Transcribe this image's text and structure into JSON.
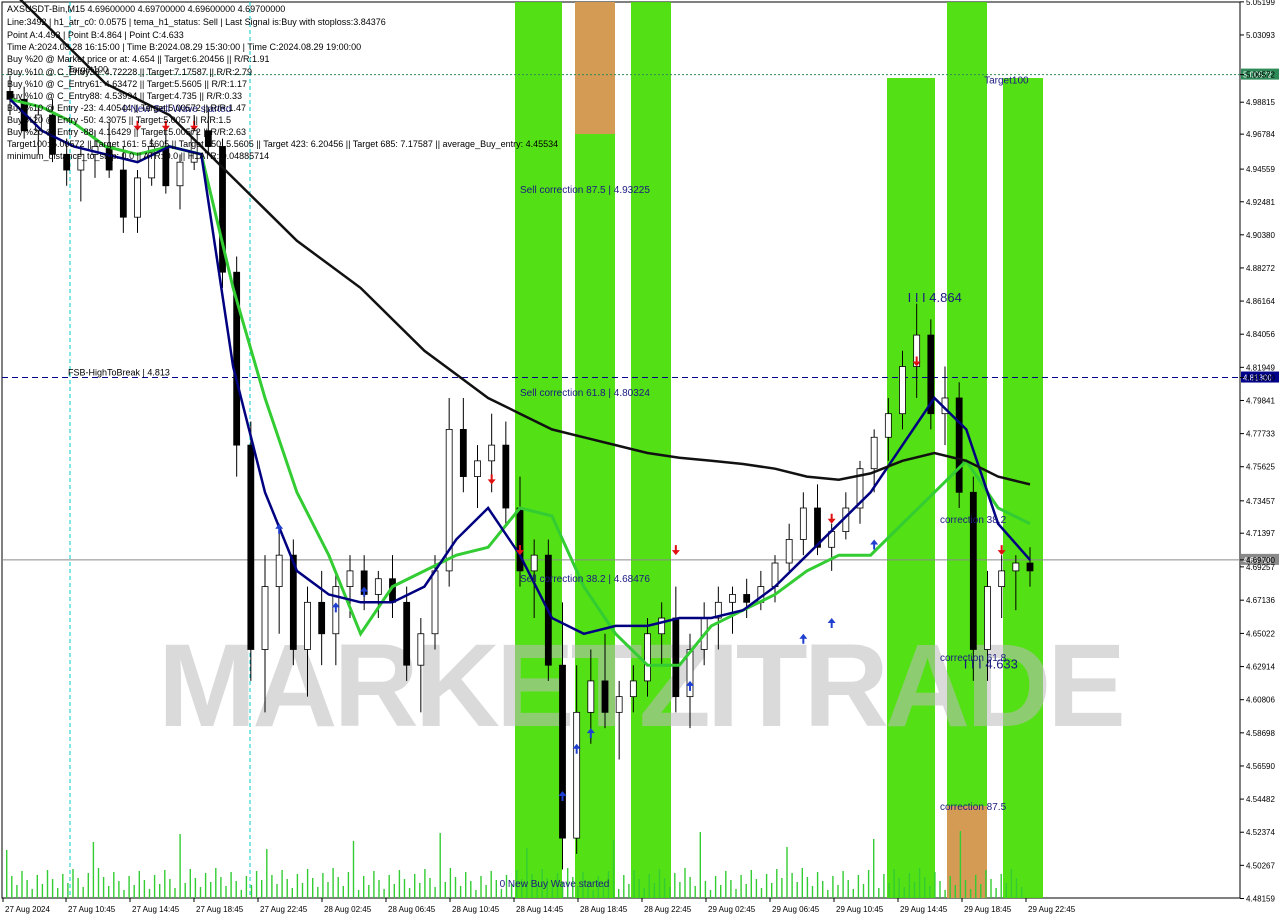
{
  "chart_data": {
    "type": "candlestick",
    "symbol_header": "AXSUSDT-Bin,M15  4.69600000 4.69700000 4.69600000 4.69700000",
    "info_lines": [
      "Line:3492 | h1_atr_c0: 0.0575 | tema_h1_status: Sell | Last Signal is:Buy with stoploss:3.84376",
      "Point A:4.493 | Point B:4.864 | Point C:4.633",
      "Time A:2024.08.28 16:15:00 | Time B:2024.08.29 15:30:00 | Time C:2024.08.29 19:00:00",
      "Buy %20 @ Market price or at: 4.654 || Target:6.20456 || R/R:1.91",
      "Buy %10 @ C_Entry38: 4.72228 || Target:7.17587 || R/R:2.79",
      "Buy %10 @ C_Entry61: 4.63472 || Target:5.5605 || R/R:1.17",
      "Buy %10 @ C_Entry88: 4.53994 || Target:4.735 || R/R:0.33",
      "Buy %10 @ Entry -23: 4.40544 || Target:5.00572 || R/R:1.47",
      "Buy %20 @ Entry -50: 4.3075 || Target:5.0057 || R/R:1.5",
      "Buy %20 @ Entry -88: 4.16429 || Target:5.00572 || R/R:2.63",
      "Target100: 5.00572 || Target 161: 5.5605 || Target 250: 5.5605 || Target 423: 6.20456 || Target 685: 7.17587 || average_Buy_entry: 4.45534",
      "minimum_distance_to_stop: 0.0 || ATR: 0.0 || H1ATR: 0.04885714"
    ],
    "ylim": [
      4.4819,
      5.0519
    ],
    "y_ticks": [
      "5.05199",
      "5.03093",
      "5.00572",
      "4.98815",
      "4.96784",
      "4.94559",
      "4.92481",
      "4.90380",
      "4.88272",
      "4.86164",
      "4.84056",
      "4.81949",
      "4.81300",
      "4.79841",
      "4.77733",
      "4.75625",
      "4.73457",
      "4.71397",
      "4.69700",
      "4.69257",
      "4.67136",
      "4.65022",
      "4.62914",
      "4.60806",
      "4.58698",
      "4.56590",
      "4.54482",
      "4.52374",
      "4.50267",
      "4.48159"
    ],
    "x_labels": [
      "27 Aug 2024",
      "27 Aug 10:45",
      "27 Aug 14:45",
      "27 Aug 18:45",
      "27 Aug 22:45",
      "28 Aug 02:45",
      "28 Aug 06:45",
      "28 Aug 10:45",
      "28 Aug 14:45",
      "28 Aug 18:45",
      "28 Aug 22:45",
      "29 Aug 02:45",
      "29 Aug 06:45",
      "29 Aug 10:45",
      "29 Aug 14:45",
      "29 Aug 18:45",
      "29 Aug 22:45"
    ],
    "price_levels": [
      {
        "label": "FSB-HighToBreak | 4.813",
        "value": 4.813,
        "price_tag": "4.81300",
        "color": "#00008b",
        "style": "dashed"
      },
      {
        "label": "Target100",
        "value": 5.00572,
        "price_tag": "5.00572",
        "color": "#2e8b57",
        "style": "dotted"
      },
      {
        "label": "",
        "value": 4.697,
        "price_tag": "4.69700",
        "color": "#8a8a8a",
        "style": "solid"
      }
    ],
    "zones": [
      {
        "label": "Sell correction 87.5 | 4.93225",
        "price": 4.93225,
        "color": "#44dd00"
      },
      {
        "label": "Sell correction 61.8 | 4.80324",
        "price": 4.80324,
        "color": "#44dd00"
      },
      {
        "label": "Sell correction 38.2 | 4.68476",
        "price": 4.68476,
        "color": "#44dd00"
      },
      {
        "label": "correction 38.2",
        "price": 4.72228,
        "color": "#44dd00"
      },
      {
        "label": "correction 61.8",
        "price": 4.63472,
        "color": "#44dd00"
      },
      {
        "label": "correction 87.5",
        "price": 4.53994,
        "color": "#44dd00"
      }
    ],
    "annotations": [
      {
        "text": "0 New Sell Wave started",
        "price": 4.982,
        "bar": 44
      },
      {
        "text": "0 New Buy Wave started",
        "price": 4.489,
        "bar": 192
      },
      {
        "text": "I I I 4.864",
        "price": 4.861,
        "bar": 352
      },
      {
        "text": "I I I 4.633",
        "price": 4.628,
        "bar": 374
      },
      {
        "text": "Target100",
        "price": 5.0,
        "bar": 382
      }
    ],
    "series": [
      {
        "name": "EMA green",
        "color": "#33cc33",
        "values": [
          4.99,
          4.985,
          4.975,
          4.96,
          4.955,
          4.96,
          4.955,
          4.87,
          4.8,
          4.74,
          4.7,
          4.65,
          4.68,
          4.69,
          4.7,
          4.705,
          4.73,
          4.725,
          4.68,
          4.65,
          4.63,
          4.63,
          4.655,
          4.665,
          4.675,
          4.69,
          4.7,
          4.7,
          4.72,
          4.74,
          4.76,
          4.73,
          4.72
        ]
      },
      {
        "name": "EMA navy",
        "color": "#000080",
        "values": [
          4.99,
          4.97,
          4.96,
          4.955,
          4.95,
          4.96,
          4.955,
          4.82,
          4.74,
          4.69,
          4.675,
          4.67,
          4.67,
          4.68,
          4.71,
          4.73,
          4.7,
          4.66,
          4.65,
          4.655,
          4.655,
          4.66,
          4.66,
          4.665,
          4.68,
          4.7,
          4.72,
          4.74,
          4.77,
          4.8,
          4.78,
          4.72,
          4.697
        ]
      },
      {
        "name": "SMA black",
        "color": "#111111",
        "values": [
          5.06,
          5.04,
          5.02,
          5.0,
          4.99,
          4.98,
          4.96,
          4.94,
          4.92,
          4.9,
          4.885,
          4.87,
          4.85,
          4.83,
          4.815,
          4.8,
          4.79,
          4.78,
          4.775,
          4.77,
          4.765,
          4.762,
          4.76,
          4.758,
          4.755,
          4.75,
          4.748,
          4.752,
          4.76,
          4.765,
          4.76,
          4.75,
          4.745
        ]
      }
    ],
    "candles": [
      [
        4.995,
        5.005,
        4.98,
        4.99
      ],
      [
        4.99,
        4.998,
        4.965,
        4.97
      ],
      [
        4.97,
        4.985,
        4.955,
        4.98
      ],
      [
        4.98,
        4.99,
        4.95,
        4.955
      ],
      [
        4.955,
        4.965,
        4.935,
        4.945
      ],
      [
        4.945,
        4.96,
        4.925,
        4.955
      ],
      [
        4.955,
        4.97,
        4.94,
        4.96
      ],
      [
        4.96,
        4.975,
        4.94,
        4.945
      ],
      [
        4.945,
        4.96,
        4.905,
        4.915
      ],
      [
        4.915,
        4.945,
        4.905,
        4.94
      ],
      [
        4.94,
        4.965,
        4.935,
        4.96
      ],
      [
        4.96,
        4.975,
        4.93,
        4.935
      ],
      [
        4.935,
        4.955,
        4.92,
        4.95
      ],
      [
        4.95,
        4.98,
        4.945,
        4.97
      ],
      [
        4.97,
        4.985,
        4.955,
        4.96
      ],
      [
        4.96,
        4.965,
        4.87,
        4.88
      ],
      [
        4.88,
        4.89,
        4.75,
        4.77
      ],
      [
        4.77,
        4.785,
        4.62,
        4.64
      ],
      [
        4.64,
        4.7,
        4.6,
        4.68
      ],
      [
        4.68,
        4.72,
        4.65,
        4.7
      ],
      [
        4.7,
        4.71,
        4.63,
        4.64
      ],
      [
        4.64,
        4.68,
        4.61,
        4.67
      ],
      [
        4.67,
        4.69,
        4.63,
        4.65
      ],
      [
        4.65,
        4.69,
        4.63,
        4.68
      ],
      [
        4.68,
        4.7,
        4.66,
        4.69
      ],
      [
        4.69,
        4.7,
        4.665,
        4.675
      ],
      [
        4.675,
        4.69,
        4.66,
        4.685
      ],
      [
        4.685,
        4.7,
        4.66,
        4.67
      ],
      [
        4.67,
        4.68,
        4.62,
        4.63
      ],
      [
        4.63,
        4.66,
        4.6,
        4.65
      ],
      [
        4.65,
        4.7,
        4.64,
        4.69
      ],
      [
        4.69,
        4.8,
        4.68,
        4.78
      ],
      [
        4.78,
        4.8,
        4.74,
        4.75
      ],
      [
        4.75,
        4.77,
        4.73,
        4.76
      ],
      [
        4.76,
        4.79,
        4.74,
        4.77
      ],
      [
        4.77,
        4.785,
        4.72,
        4.73
      ],
      [
        4.73,
        4.75,
        4.68,
        4.69
      ],
      [
        4.69,
        4.71,
        4.66,
        4.7
      ],
      [
        4.7,
        4.71,
        4.62,
        4.63
      ],
      [
        4.63,
        4.67,
        4.5,
        4.52
      ],
      [
        4.52,
        4.63,
        4.51,
        4.6
      ],
      [
        4.6,
        4.64,
        4.58,
        4.62
      ],
      [
        4.62,
        4.65,
        4.59,
        4.6
      ],
      [
        4.6,
        4.62,
        4.57,
        4.61
      ],
      [
        4.61,
        4.63,
        4.6,
        4.62
      ],
      [
        4.62,
        4.66,
        4.61,
        4.65
      ],
      [
        4.65,
        4.67,
        4.63,
        4.66
      ],
      [
        4.66,
        4.68,
        4.6,
        4.61
      ],
      [
        4.61,
        4.65,
        4.59,
        4.64
      ],
      [
        4.64,
        4.67,
        4.63,
        4.66
      ],
      [
        4.66,
        4.68,
        4.64,
        4.67
      ],
      [
        4.67,
        4.68,
        4.65,
        4.675
      ],
      [
        4.675,
        4.685,
        4.66,
        4.67
      ],
      [
        4.67,
        4.69,
        4.665,
        4.68
      ],
      [
        4.68,
        4.7,
        4.67,
        4.695
      ],
      [
        4.695,
        4.72,
        4.69,
        4.71
      ],
      [
        4.71,
        4.74,
        4.7,
        4.73
      ],
      [
        4.73,
        4.745,
        4.7,
        4.705
      ],
      [
        4.705,
        4.72,
        4.69,
        4.715
      ],
      [
        4.715,
        4.74,
        4.71,
        4.73
      ],
      [
        4.73,
        4.76,
        4.72,
        4.755
      ],
      [
        4.755,
        4.78,
        4.74,
        4.775
      ],
      [
        4.775,
        4.8,
        4.76,
        4.79
      ],
      [
        4.79,
        4.83,
        4.78,
        4.82
      ],
      [
        4.82,
        4.86,
        4.8,
        4.84
      ],
      [
        4.84,
        4.85,
        4.78,
        4.79
      ],
      [
        4.79,
        4.82,
        4.77,
        4.8
      ],
      [
        4.8,
        4.81,
        4.73,
        4.74
      ],
      [
        4.74,
        4.75,
        4.62,
        4.64
      ],
      [
        4.64,
        4.69,
        4.62,
        4.68
      ],
      [
        4.68,
        4.7,
        4.66,
        4.69
      ],
      [
        4.69,
        4.7,
        4.665,
        4.695
      ],
      [
        4.695,
        4.705,
        4.68,
        4.69
      ]
    ]
  }
}
